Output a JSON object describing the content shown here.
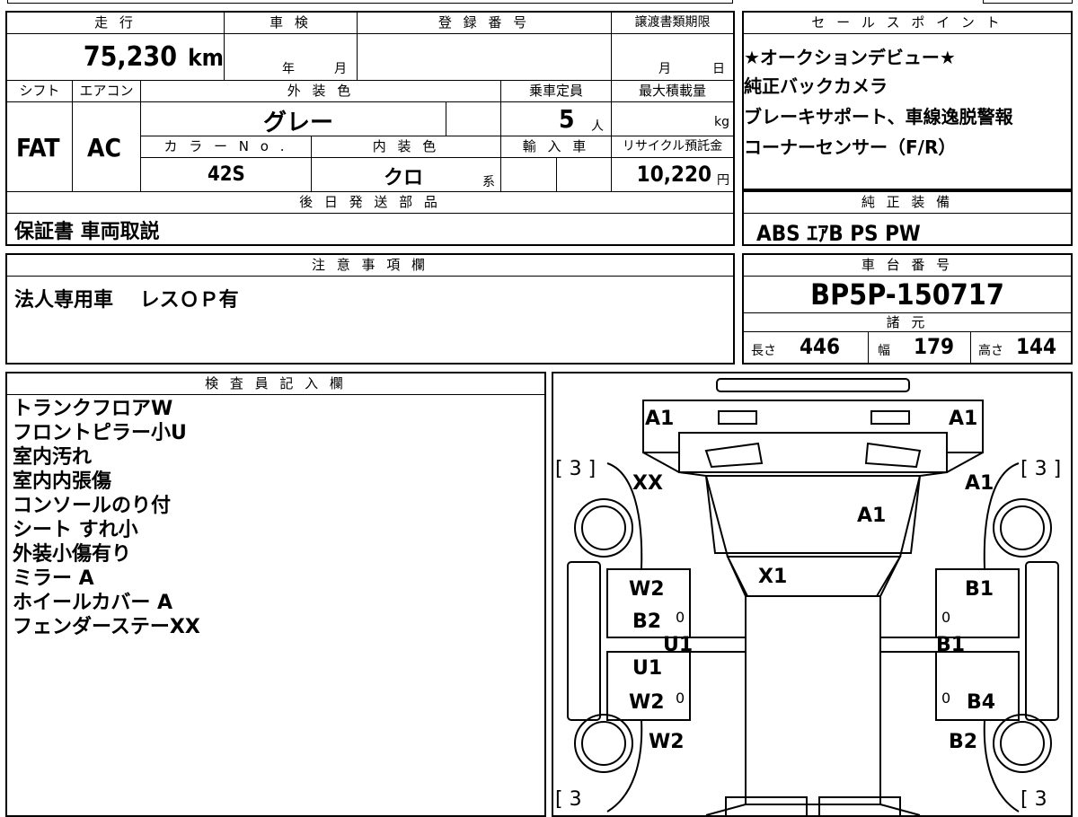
{
  "vehicle": {
    "headers": {
      "mileage": "走 行",
      "inspection": "車 検",
      "registration": "登 録 番 号",
      "transfer_deadline": "譲渡書類期限",
      "shift": "シフト",
      "aircon": "エアコン",
      "exterior_color": "外 装 色",
      "capacity": "乗車定員",
      "max_load": "最大積載量",
      "color_no": "カ ラ ー N o .",
      "interior_color": "内 装 色",
      "import": "輸 入 車",
      "recycle_fee": "リサイクル預託金",
      "later_parts": "後 日 発 送 部 品"
    },
    "mileage": "75,230",
    "mileage_unit": "km",
    "inspection_year_unit": "年",
    "inspection_month_unit": "月",
    "transfer_month_unit": "月",
    "transfer_day_unit": "日",
    "shift": "FAT",
    "aircon": "AC",
    "exterior_color": "グレー",
    "capacity": "5",
    "capacity_unit": "人",
    "max_load_unit": "kg",
    "color_no": "42S",
    "interior_color": "クロ",
    "interior_color_suffix": "系",
    "recycle_fee": "10,220",
    "recycle_fee_unit": "円",
    "later_parts": "保証書 車両取説"
  },
  "sales_points": {
    "header": "セ ー ル ス ポ イ ン ト",
    "lines": [
      "★オークションデビュー★",
      "純正バックカメラ",
      "ブレーキサポート、車線逸脱警報",
      "コーナーセンサー（F/R）"
    ]
  },
  "equipment": {
    "header": "純 正 装 備",
    "value": "ABS ｴｱB PS PW"
  },
  "notes": {
    "header": "注 意 事 項 欄",
    "value": "法人専用車　 レスＯＰ有"
  },
  "chassis": {
    "header": "車 台 番 号",
    "value": "BP5P-150717",
    "specs_header": "諸 元",
    "length_label": "長さ",
    "length": "446",
    "width_label": "幅",
    "width": "179",
    "height_label": "高さ",
    "height": "144"
  },
  "inspector": {
    "header": "検 査 員 記 入 欄",
    "lines": [
      "トランクフロアW",
      "フロントピラー小U",
      "室内汚れ",
      "室内内張傷",
      "コンソールのり付",
      "シート すれ小",
      "外装小傷有り",
      "ミラー A",
      "ホイールカバー A",
      "フェンダーステーXX"
    ]
  },
  "diagram": {
    "labels": {
      "a1_top_left": "A1",
      "a1_top_right": "A1",
      "tire_fl": "[ 3 ]",
      "tire_fr": "[ 3 ]",
      "tire_rl": "[ 3",
      "tire_rr": "[ 3",
      "xx": "XX",
      "a1_right": "A1",
      "a1_hood": "A1",
      "x1": "X1",
      "w2_left_front": "W2",
      "b1_right_front": "B1",
      "b2_left": "B2",
      "u1_left": "U1",
      "b1_right_mid": "B1",
      "u1_left_lower": "U1",
      "w2_left_rear": "W2",
      "b4_right": "B4",
      "w2_left_bottom": "W2",
      "b2_right_bottom": "B2",
      "zero_1": "0",
      "zero_2": "0",
      "zero_3": "0",
      "zero_4": "0"
    }
  }
}
